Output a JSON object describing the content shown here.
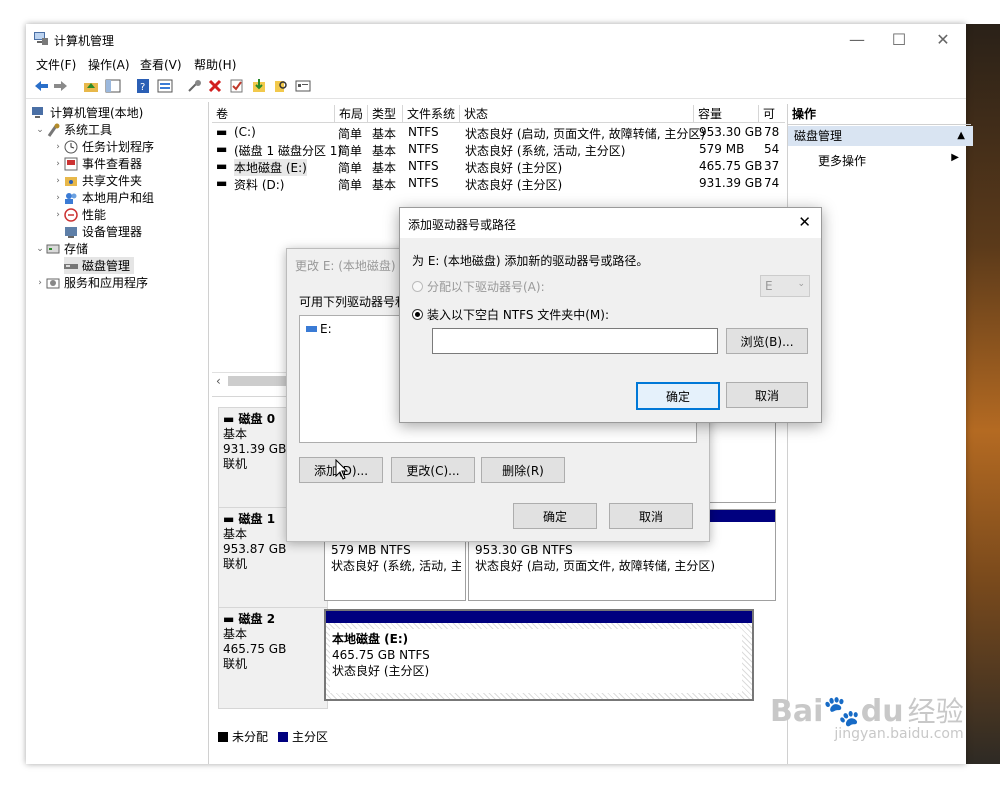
{
  "window": {
    "title": "计算机管理",
    "controls": [
      "—",
      "☐",
      "✕"
    ]
  },
  "menu": [
    "文件(F)",
    "操作(A)",
    "查看(V)",
    "帮助(H)"
  ],
  "tree": {
    "root": "计算机管理(本地)",
    "system_tools": "系统工具",
    "task_scheduler": "任务计划程序",
    "event_viewer": "事件查看器",
    "shared_folders": "共享文件夹",
    "local_users": "本地用户和组",
    "performance": "性能",
    "device_manager": "设备管理器",
    "storage": "存储",
    "disk_management": "磁盘管理",
    "services_apps": "服务和应用程序"
  },
  "volumes": {
    "headers": [
      "卷",
      "布局",
      "类型",
      "文件系统",
      "状态",
      "容量",
      "可"
    ],
    "rows": [
      {
        "name": "(C:)",
        "layout": "简单",
        "type": "基本",
        "fs": "NTFS",
        "status": "状态良好 (启动, 页面文件, 故障转储, 主分区)",
        "capacity": "953.30 GB",
        "free": "78"
      },
      {
        "name": "(磁盘 1 磁盘分区 1)",
        "layout": "简单",
        "type": "基本",
        "fs": "NTFS",
        "status": "状态良好 (系统, 活动, 主分区)",
        "capacity": "579 MB",
        "free": "54"
      },
      {
        "name": "本地磁盘 (E:)",
        "layout": "简单",
        "type": "基本",
        "fs": "NTFS",
        "status": "状态良好 (主分区)",
        "capacity": "465.75 GB",
        "free": "37"
      },
      {
        "name": "资料 (D:)",
        "layout": "简单",
        "type": "基本",
        "fs": "NTFS",
        "status": "状态良好 (主分区)",
        "capacity": "931.39 GB",
        "free": "74"
      }
    ]
  },
  "disks": [
    {
      "name": "磁盘 0",
      "type": "基本",
      "size": "931.39 GB",
      "state": "联机"
    },
    {
      "name": "磁盘 1",
      "type": "基本",
      "size": "953.87 GB",
      "state": "联机",
      "p1_size": "579 MB NTFS",
      "p1_status": "状态良好 (系统, 活动, 主分",
      "p2_size": "953.30 GB NTFS",
      "p2_status": "状态良好 (启动, 页面文件, 故障转储, 主分区)"
    },
    {
      "name": "磁盘 2",
      "type": "基本",
      "size": "465.75 GB",
      "state": "联机",
      "p_name": "本地磁盘 (E:)",
      "p_size": "465.75 GB NTFS",
      "p_status": "状态良好 (主分区)"
    }
  ],
  "legend": {
    "unallocated": "未分配",
    "primary": "主分区"
  },
  "actions": {
    "header": "操作",
    "section": "磁盘管理",
    "more": "更多操作"
  },
  "change_dialog": {
    "title": "更改 E: (本地磁盘) 的",
    "intro": "可用下列驱动器号和",
    "item": "E:",
    "add": "添加(D)...",
    "change": "更改(C)...",
    "remove": "删除(R)",
    "ok": "确定",
    "cancel": "取消"
  },
  "add_dialog": {
    "title": "添加驱动器号或路径",
    "desc": "为 E: (本地磁盘) 添加新的驱动器号或路径。",
    "option1": "分配以下驱动器号(A):",
    "letter": "E",
    "option2": "装入以下空白 NTFS 文件夹中(M):",
    "path": "",
    "browse": "浏览(B)...",
    "ok": "确定",
    "cancel": "取消"
  },
  "watermark": {
    "brand": "Bai",
    "brand2": "du",
    "cn": "经验",
    "url": "jingyan.baidu.com"
  },
  "colors": {
    "primary_partition": "#00007f",
    "unallocated": "#000000",
    "accent": "#0078d7"
  }
}
